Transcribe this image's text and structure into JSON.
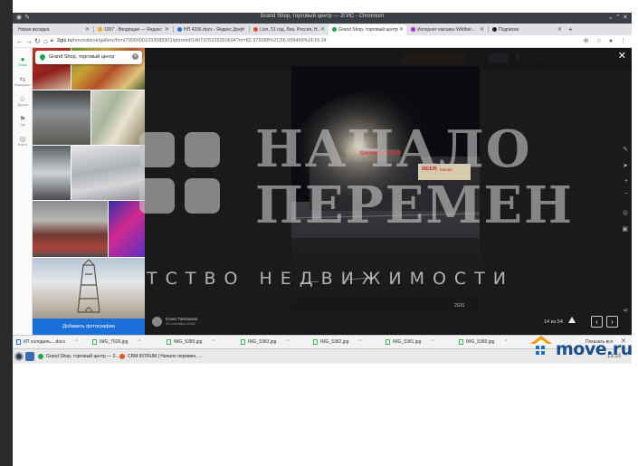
{
  "browser": {
    "window_title": "Grand Shop, торговый центр — 2ГИС - Chromium",
    "tabs": [
      {
        "label": "Новая вкладка",
        "favicon": "#9e9e9e",
        "active": false
      },
      {
        "label": "1997 · Входящие — Яндекс",
        "favicon": "#f5a623",
        "active": false
      },
      {
        "label": "НП 4336.docx - Яндекс.Доку",
        "favicon": "#2b6fd6",
        "active": false
      },
      {
        "label": "Lion, 51 год, Лев, Россия, Н...",
        "favicon": "#e8492b",
        "active": false
      },
      {
        "label": "Grand Shop, торговый центр",
        "favicon": "#1aa64a",
        "active": true
      },
      {
        "label": "Интернет магазин Wildber...",
        "favicon": "#a82ad4",
        "active": false
      },
      {
        "label": "Подписки",
        "favicon": "#222222",
        "active": false
      }
    ],
    "url_host": "2gis.ru",
    "url_rest": "/novosibirsk/gallery/firm/70000001033088301/photoId/1407375335260694?m=82.979388%2C55.099499%2F16.34"
  },
  "sidebar": {
    "items": [
      {
        "label": "Поиск",
        "icon": "search-pin-icon",
        "active": true
      },
      {
        "label": "Маршруты",
        "icon": "route-icon",
        "active": false
      },
      {
        "label": "Друзья",
        "icon": "friends-icon",
        "active": false
      },
      {
        "label": "Где",
        "icon": "flag-icon",
        "active": false
      },
      {
        "label": "Войти",
        "icon": "login-icon",
        "active": false
      }
    ]
  },
  "panel": {
    "search_value": "Grand Shop, торговый центр",
    "add_photo": "Добавить фотографии"
  },
  "viewer": {
    "author_name": "Юлия Тайлакова",
    "author_date": "25 сентября 2018",
    "counter": "14 из 54",
    "photo_signs": {
      "store": "GRAND SHOP",
      "beer": "BEER",
      "beer_suffix": "Мания",
      "watermark": "2GIS"
    }
  },
  "watermark": {
    "line1": "НАЧАЛО",
    "line2": "ПЕРЕМЕН",
    "tagline": "ТСТВО НЕДВИЖИМОСТИ"
  },
  "downloads": {
    "items": [
      "КП холодиль....docx",
      "IMG_7526.jpg",
      "IMG_5385.jpg",
      "IMG_5383.jpg",
      "IMG_5382.jpg",
      "IMG_5381.jpg",
      "IMG_5380.jpg"
    ],
    "show_all": "Показать все"
  },
  "taskbar": {
    "items": [
      {
        "label": "Grand Shop, торговый центр — 2...",
        "favicon": "#1aa64a"
      },
      {
        "label": "CRM INTRUM | Начало перемен, ...",
        "favicon": "#e05a1c"
      }
    ],
    "clock": "13:23"
  },
  "logo": {
    "text": "move.ru"
  },
  "colors": {
    "accent_green": "#1aa64a",
    "button_blue": "#1b6fd8",
    "logo_blue": "#1b4f8c",
    "logo_orange": "#f39c12"
  }
}
